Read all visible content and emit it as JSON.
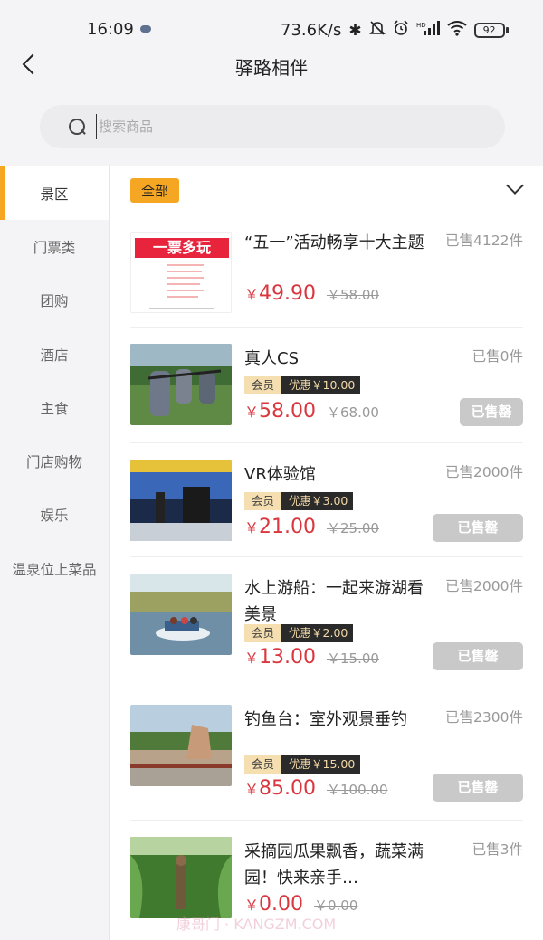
{
  "status_bar": {
    "time": "16:09",
    "network_speed": "73.6K/s",
    "icons": [
      "bluetooth-icon",
      "mute-icon",
      "alarm-icon",
      "signal-icon",
      "wifi-icon"
    ],
    "battery": "92"
  },
  "nav": {
    "title": "驿路相伴",
    "back_icon": "chevron-left-icon"
  },
  "search": {
    "placeholder": "搜索商品",
    "value": ""
  },
  "sidebar": {
    "items": [
      {
        "label": "景区",
        "active": true
      },
      {
        "label": "门票类"
      },
      {
        "label": "团购"
      },
      {
        "label": "酒店"
      },
      {
        "label": "主食"
      },
      {
        "label": "门店购物"
      },
      {
        "label": "娱乐"
      },
      {
        "label": "温泉位上菜品"
      }
    ]
  },
  "filter": {
    "tag": "全部",
    "toggle_icon": "chevron-down-icon"
  },
  "products": [
    {
      "name": "“五一”活动畅享十大主题",
      "sold": "已售4122件",
      "price": "49.90",
      "orig_price": "￥58.00",
      "thumb_text": "一票多玩"
    },
    {
      "name": "真人CS",
      "sold": "已售0件",
      "member_tag": "会员",
      "discount": "优惠￥10.00",
      "price": "58.00",
      "orig_price": "￥68.00",
      "sold_out": "已售罄"
    },
    {
      "name": "VR体验馆",
      "sold": "已售2000件",
      "member_tag": "会员",
      "discount": "优惠￥3.00",
      "price": "21.00",
      "orig_price": "￥25.00",
      "sold_out": "已售罄"
    },
    {
      "name": "水上游船：一起来游湖看美景",
      "sold": "已售2000件",
      "member_tag": "会员",
      "discount": "优惠￥2.00",
      "price": "13.00",
      "orig_price": "￥15.00",
      "sold_out": "已售罄"
    },
    {
      "name": "钓鱼台：室外观景垂钓",
      "sold": "已售2300件",
      "member_tag": "会员",
      "discount": "优惠￥15.00",
      "price": "85.00",
      "orig_price": "￥100.00",
      "sold_out": "已售罄"
    },
    {
      "name": "采摘园瓜果飘香，蔬菜满园！快来亲手…",
      "sold": "已售3件",
      "price": "0.00",
      "orig_price": "￥0.00"
    }
  ],
  "currency_symbol": "￥",
  "watermark": "康哥门 · KANGZM.COM",
  "colors": {
    "accent": "#f5a623",
    "price": "#d9363e",
    "sold_out_bg": "#c9c9c9"
  }
}
